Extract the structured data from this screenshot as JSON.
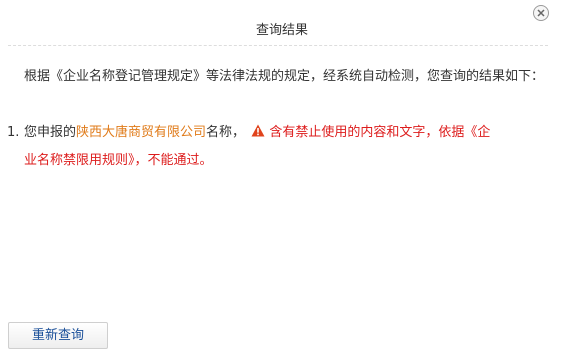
{
  "dialog": {
    "title": "查询结果",
    "close_icon": "close-icon"
  },
  "intro_text": "根据《企业名称登记管理规定》等法律法规的规定，经系统自动检测，您查询的结果如下：",
  "result": {
    "number": "1.",
    "prefix": "您申报的",
    "company_name": "陕西大唐商贸有限公司",
    "suffix": "名称，",
    "warning_icon": "warning-triangle-icon",
    "warning_line1": "含有禁止使用的内容和文字，依据《企",
    "warning_line2": "业名称禁限用规则》，不能通过。",
    "colors": {
      "company": "#e07b1a",
      "warning": "#dd1c1c"
    }
  },
  "footer": {
    "retry_label": "重新查询"
  }
}
